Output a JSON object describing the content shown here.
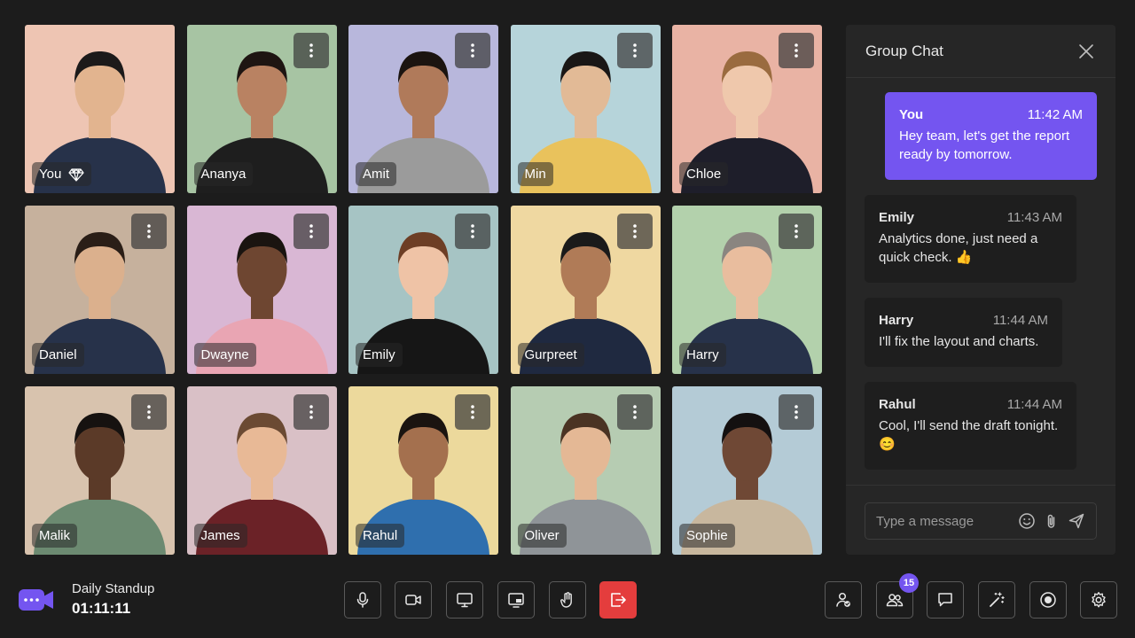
{
  "participants": [
    {
      "name": "You",
      "bg": "#eec5b3",
      "skin": "#e2b48f",
      "hair": "#1c1a1a",
      "shirt": "#27324a"
    },
    {
      "name": "Ananya",
      "bg": "#a7c4a3",
      "skin": "#b98262",
      "hair": "#1e1512",
      "shirt": "#1e1e1e"
    },
    {
      "name": "Amit",
      "bg": "#b8b7dc",
      "skin": "#b07a5a",
      "hair": "#1b1410",
      "shirt": "#9b9b9b"
    },
    {
      "name": "Min",
      "bg": "#b6d4da",
      "skin": "#e2ba96",
      "hair": "#1a1716",
      "shirt": "#e9c25c"
    },
    {
      "name": "Chloe",
      "bg": "#e9b3a4",
      "skin": "#efc8ac",
      "hair": "#9a6b3f",
      "shirt": "#1e1e2a"
    },
    {
      "name": "Daniel",
      "bg": "#c6b19d",
      "skin": "#dbb08d",
      "hair": "#2a1e17",
      "shirt": "#27324a"
    },
    {
      "name": "Dwayne",
      "bg": "#d9b7d4",
      "skin": "#6e4631",
      "hair": "#1a1410",
      "shirt": "#e9a5b3"
    },
    {
      "name": "Emily",
      "bg": "#a6c4c4",
      "skin": "#efc3a6",
      "hair": "#6d3e25",
      "shirt": "#161616"
    },
    {
      "name": "Gurpreet",
      "bg": "#efd8a1",
      "skin": "#b07b57",
      "hair": "#1a1a1a",
      "shirt": "#1f2940"
    },
    {
      "name": "Harry",
      "bg": "#b3d1ac",
      "skin": "#e9bd9e",
      "hair": "#8a8580",
      "shirt": "#27324a"
    },
    {
      "name": "Malik",
      "bg": "#d8c3ae",
      "skin": "#5b3a28",
      "hair": "#161210",
      "shirt": "#6c8a71"
    },
    {
      "name": "James",
      "bg": "#d9c0c6",
      "skin": "#e8b996",
      "hair": "#6b4a33",
      "shirt": "#6b2227"
    },
    {
      "name": "Rahul",
      "bg": "#ecd99c",
      "skin": "#a4704e",
      "hair": "#1a1410",
      "shirt": "#2f6fae"
    },
    {
      "name": "Oliver",
      "bg": "#b6ccb2",
      "skin": "#e4b895",
      "hair": "#4a3323",
      "shirt": "#8f9498"
    },
    {
      "name": "Sophie",
      "bg": "#b4cbd6",
      "skin": "#6f4835",
      "hair": "#141010",
      "shirt": "#c8b79e"
    }
  ],
  "chat": {
    "title": "Group Chat",
    "messages": [
      {
        "author": "You",
        "time": "11:42 AM",
        "text": "Hey team, let's get the report ready by tomorrow."
      },
      {
        "author": "Emily",
        "time": "11:43 AM",
        "text": "Analytics done, just need a quick check. 👍"
      },
      {
        "author": "Harry",
        "time": "11:44 AM",
        "text": "I'll fix the layout and charts."
      },
      {
        "author": "Rahul",
        "time": "11:44 AM",
        "text": "Cool, I'll send the draft tonight. 😊"
      }
    ],
    "input_placeholder": "Type a message"
  },
  "meeting": {
    "title": "Daily Standup",
    "timer": "01:11:11"
  },
  "participants_count": "15",
  "colors": {
    "accent": "#7455f0",
    "leave": "#e43d3d",
    "panel": "#262626",
    "background": "#1c1c1c"
  }
}
